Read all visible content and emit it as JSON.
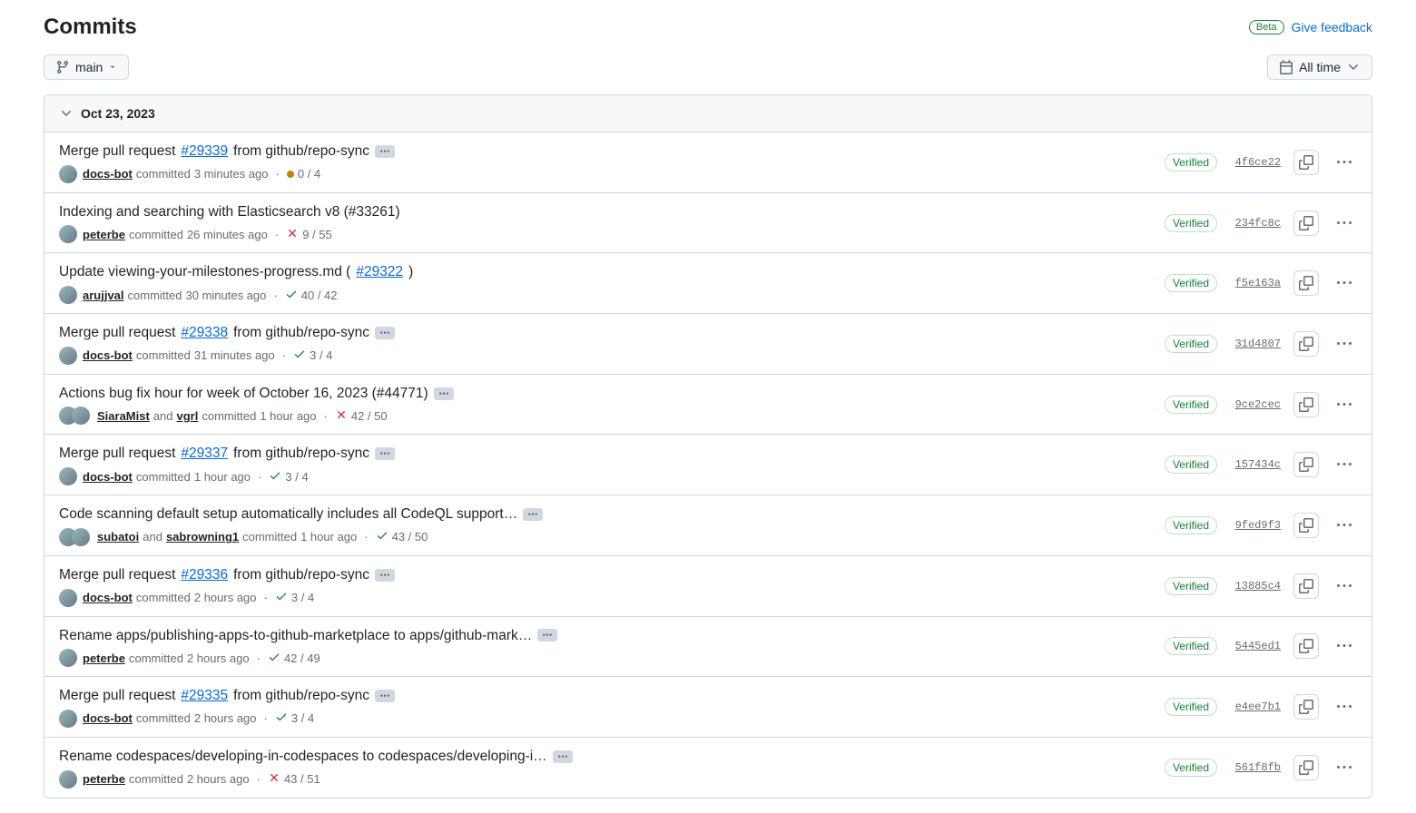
{
  "header": {
    "title": "Commits",
    "beta_label": "Beta",
    "feedback_label": "Give feedback"
  },
  "controls": {
    "branch": "main",
    "time_filter": "All time"
  },
  "group": {
    "date": "Oct 23, 2023",
    "verified_label": "Verified",
    "committed_label": "committed",
    "and_label": "and"
  },
  "commits": [
    {
      "title_parts": [
        "Merge pull request ",
        "#29339",
        " from github/repo-sync"
      ],
      "has_ellipsis": true,
      "authors": [
        "docs-bot"
      ],
      "time_ago": "3 minutes ago",
      "status": "pending",
      "checks": "0 / 4",
      "sha": "4f6ce22"
    },
    {
      "title_parts": [
        "Indexing and searching with Elasticsearch v8 (#33261)"
      ],
      "has_ellipsis": false,
      "authors": [
        "peterbe"
      ],
      "time_ago": "26 minutes ago",
      "status": "fail",
      "checks": "9 / 55",
      "sha": "234fc8c"
    },
    {
      "title_parts": [
        "Update viewing-your-milestones-progress.md (",
        "#29322",
        ")"
      ],
      "has_ellipsis": false,
      "authors": [
        "arujjval"
      ],
      "time_ago": "30 minutes ago",
      "status": "pass",
      "checks": "40 / 42",
      "sha": "f5e163a"
    },
    {
      "title_parts": [
        "Merge pull request ",
        "#29338",
        " from github/repo-sync"
      ],
      "has_ellipsis": true,
      "authors": [
        "docs-bot"
      ],
      "time_ago": "31 minutes ago",
      "status": "pass",
      "checks": "3 / 4",
      "sha": "31d4807"
    },
    {
      "title_parts": [
        "Actions bug fix hour for week of October 16, 2023 (#44771)"
      ],
      "has_ellipsis": true,
      "authors": [
        "SiaraMist",
        "vgrl"
      ],
      "time_ago": "1 hour ago",
      "status": "fail",
      "checks": "42 / 50",
      "sha": "9ce2cec"
    },
    {
      "title_parts": [
        "Merge pull request ",
        "#29337",
        " from github/repo-sync"
      ],
      "has_ellipsis": true,
      "authors": [
        "docs-bot"
      ],
      "time_ago": "1 hour ago",
      "status": "pass",
      "checks": "3 / 4",
      "sha": "157434c"
    },
    {
      "title_parts": [
        "Code scanning default setup automatically includes all CodeQL support…"
      ],
      "has_ellipsis": true,
      "authors": [
        "subatoi",
        "sabrowning1"
      ],
      "time_ago": "1 hour ago",
      "status": "pass",
      "checks": "43 / 50",
      "sha": "9fed9f3"
    },
    {
      "title_parts": [
        "Merge pull request ",
        "#29336",
        " from github/repo-sync"
      ],
      "has_ellipsis": true,
      "authors": [
        "docs-bot"
      ],
      "time_ago": "2 hours ago",
      "status": "pass",
      "checks": "3 / 4",
      "sha": "13885c4"
    },
    {
      "title_parts": [
        "Rename apps/publishing-apps-to-github-marketplace to apps/github-mark…"
      ],
      "has_ellipsis": true,
      "authors": [
        "peterbe"
      ],
      "time_ago": "2 hours ago",
      "status": "pass",
      "checks": "42 / 49",
      "sha": "5445ed1"
    },
    {
      "title_parts": [
        "Merge pull request ",
        "#29335",
        " from github/repo-sync"
      ],
      "has_ellipsis": true,
      "authors": [
        "docs-bot"
      ],
      "time_ago": "2 hours ago",
      "status": "pass",
      "checks": "3 / 4",
      "sha": "e4ee7b1"
    },
    {
      "title_parts": [
        "Rename codespaces/developing-in-codespaces to codespaces/developing-i…"
      ],
      "has_ellipsis": true,
      "authors": [
        "peterbe"
      ],
      "time_ago": "2 hours ago",
      "status": "fail",
      "checks": "43 / 51",
      "sha": "561f8fb"
    }
  ]
}
